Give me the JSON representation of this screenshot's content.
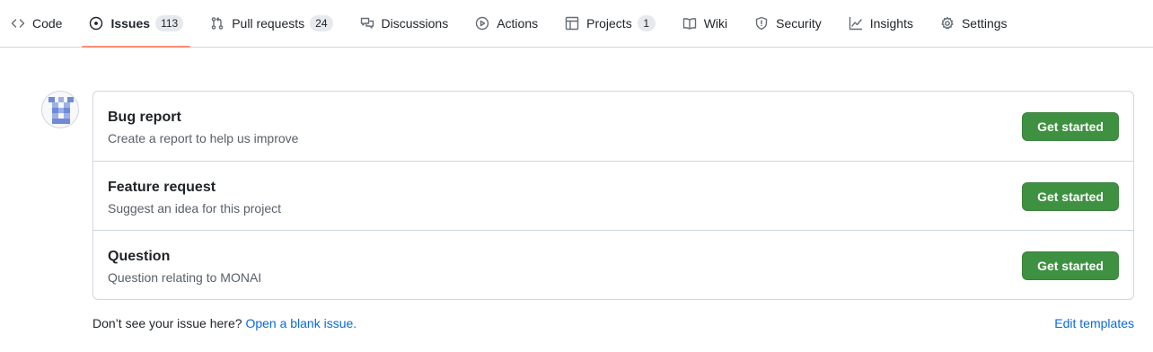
{
  "nav": {
    "tabs": [
      {
        "label": "Code",
        "icon": "code-icon"
      },
      {
        "label": "Issues",
        "icon": "issue-opened-icon",
        "count": "113",
        "selected": true
      },
      {
        "label": "Pull requests",
        "icon": "git-pull-request-icon",
        "count": "24"
      },
      {
        "label": "Discussions",
        "icon": "comment-discussion-icon"
      },
      {
        "label": "Actions",
        "icon": "play-icon"
      },
      {
        "label": "Projects",
        "icon": "table-icon",
        "count": "1"
      },
      {
        "label": "Wiki",
        "icon": "book-icon"
      },
      {
        "label": "Security",
        "icon": "shield-icon"
      },
      {
        "label": "Insights",
        "icon": "graph-icon"
      },
      {
        "label": "Settings",
        "icon": "gear-icon"
      }
    ],
    "selected_underline_color": "#fd8c73"
  },
  "avatar": {
    "icon": "identicon-avatar",
    "color": "#6f8ad8"
  },
  "templates": [
    {
      "title": "Bug report",
      "description": "Create a report to help us improve",
      "button": "Get started"
    },
    {
      "title": "Feature request",
      "description": "Suggest an idea for this project",
      "button": "Get started"
    },
    {
      "title": "Question",
      "description": "Question relating to MONAI",
      "button": "Get started"
    }
  ],
  "footer": {
    "prompt": "Don’t see your issue here?",
    "blank_issue_link": "Open a blank issue.",
    "edit_templates_link": "Edit templates"
  },
  "colors": {
    "primary_button": "#3f9142",
    "link": "#0969da",
    "border": "#d0d7de"
  }
}
